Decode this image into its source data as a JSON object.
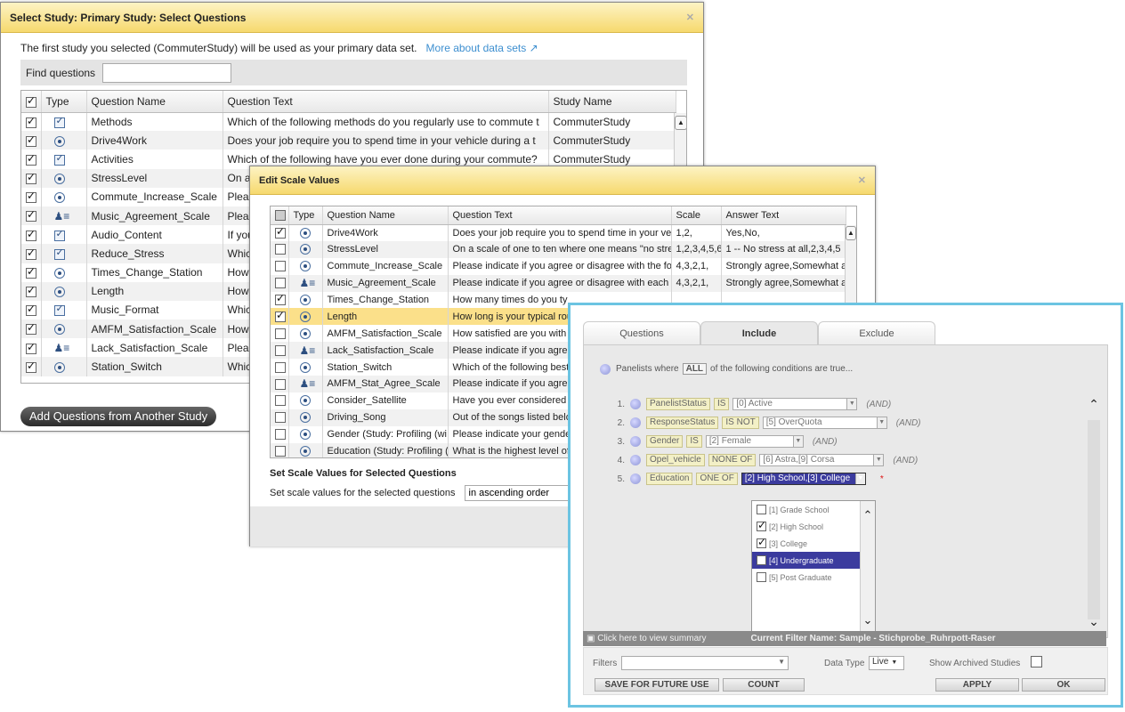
{
  "dialog1": {
    "title": "Select Study: Primary Study: Select Questions",
    "subtitle": "The first study you selected  (CommuterStudy)  will be used as your primary data set.",
    "more_link": "More about data sets",
    "find_label": "Find questions",
    "find_placeholder": "",
    "columns": [
      "Type",
      "Question Name",
      "Question Text",
      "Study Name"
    ],
    "rows": [
      {
        "checked": true,
        "type": "check",
        "name": "Methods",
        "text": "Which of the following methods do you regularly use to commute t",
        "study": "CommuterStudy"
      },
      {
        "checked": true,
        "type": "radio",
        "name": "Drive4Work",
        "text": "Does your job require you to spend time in your vehicle during a t",
        "study": "CommuterStudy"
      },
      {
        "checked": true,
        "type": "check",
        "name": "Activities",
        "text": "Which of the following have you ever done during your commute?",
        "study": "CommuterStudy"
      },
      {
        "checked": true,
        "type": "radio",
        "name": "StressLevel",
        "text": "On a",
        "study": ""
      },
      {
        "checked": true,
        "type": "radio",
        "name": "Commute_Increase_Scale",
        "text": "Pleas",
        "study": ""
      },
      {
        "checked": true,
        "type": "scale",
        "name": "Music_Agreement_Scale",
        "text": "Pleas",
        "study": ""
      },
      {
        "checked": true,
        "type": "check",
        "name": "Audio_Content",
        "text": "If you",
        "study": ""
      },
      {
        "checked": true,
        "type": "check",
        "name": "Reduce_Stress",
        "text": "Which",
        "study": ""
      },
      {
        "checked": true,
        "type": "radio",
        "name": "Times_Change_Station",
        "text": "How",
        "study": ""
      },
      {
        "checked": true,
        "type": "radio",
        "name": "Length",
        "text": "How",
        "study": ""
      },
      {
        "checked": true,
        "type": "check",
        "name": "Music_Format",
        "text": "Which",
        "study": ""
      },
      {
        "checked": true,
        "type": "radio",
        "name": "AMFM_Satisfaction_Scale",
        "text": "How",
        "study": ""
      },
      {
        "checked": true,
        "type": "scale",
        "name": "Lack_Satisfaction_Scale",
        "text": "Pleas",
        "study": ""
      },
      {
        "checked": true,
        "type": "radio",
        "name": "Station_Switch",
        "text": "Which",
        "study": ""
      }
    ],
    "add_button": "Add Questions from Another Study"
  },
  "dialog2": {
    "title": "Edit Scale Values",
    "columns": [
      "Type",
      "Question Name",
      "Question Text",
      "Scale",
      "Answer Text"
    ],
    "rows": [
      {
        "checked": true,
        "type": "radio",
        "name": "Drive4Work",
        "text": "Does your job require you to spend time in your ve",
        "scale": "1,2,",
        "answer": "Yes,No,"
      },
      {
        "checked": false,
        "type": "radio",
        "name": "StressLevel",
        "text": "On a scale of one to ten where one means \"no stres",
        "scale": "1,2,3,4,5,6",
        "answer": "1 -- No stress at all,2,3,4,5"
      },
      {
        "checked": false,
        "type": "radio",
        "name": "Commute_Increase_Scale",
        "text": "Please indicate if you agree or disagree with the fol",
        "scale": "4,3,2,1,",
        "answer": "Strongly agree,Somewhat a"
      },
      {
        "checked": false,
        "type": "scale",
        "name": "Music_Agreement_Scale",
        "text": "Please indicate if you agree or disagree with each o",
        "scale": "4,3,2,1,",
        "answer": "Strongly agree,Somewhat a"
      },
      {
        "checked": true,
        "type": "radio",
        "name": "Times_Change_Station",
        "text": "How many times do you ty",
        "scale": "",
        "answer": ""
      },
      {
        "checked": true,
        "type": "radio",
        "name": "Length",
        "text": "How long is your typical rou",
        "scale": "",
        "answer": "",
        "selected": true
      },
      {
        "checked": false,
        "type": "radio",
        "name": "AMFM_Satisfaction_Scale",
        "text": "How satisfied are you with",
        "scale": "",
        "answer": ""
      },
      {
        "checked": false,
        "type": "scale",
        "name": "Lack_Satisfaction_Scale",
        "text": "Please indicate if you agree",
        "scale": "",
        "answer": ""
      },
      {
        "checked": false,
        "type": "radio",
        "name": "Station_Switch",
        "text": "Which of the following best",
        "scale": "",
        "answer": ""
      },
      {
        "checked": false,
        "type": "scale",
        "name": "AMFM_Stat_Agree_Scale",
        "text": "Please indicate if you agree",
        "scale": "",
        "answer": ""
      },
      {
        "checked": false,
        "type": "radio",
        "name": "Consider_Satellite",
        "text": "Have you ever considered p",
        "scale": "",
        "answer": ""
      },
      {
        "checked": false,
        "type": "radio",
        "name": "Driving_Song",
        "text": "Out of the songs listed belo",
        "scale": "",
        "answer": ""
      },
      {
        "checked": false,
        "type": "radio",
        "name": "Gender (Study: Profiling (wi",
        "text": "Please indicate your gender",
        "scale": "",
        "answer": ""
      },
      {
        "checked": false,
        "type": "radio",
        "name": "Education (Study: Profiling (",
        "text": "What is the highest level of",
        "scale": "",
        "answer": ""
      }
    ],
    "section_title": "Set Scale Values for Selected Questions",
    "section_label": "Set scale values for the selected questions",
    "order_value": "in ascending order"
  },
  "dialog3": {
    "tabs": [
      "Questions",
      "Include",
      "Exclude"
    ],
    "head_pre": "Panelists where",
    "head_all": "ALL",
    "head_post": "of the following conditions are true...",
    "conditions": [
      {
        "num": "1.",
        "field": "PanelistStatus",
        "op": "IS",
        "value": "[0] Active",
        "join": "(AND)"
      },
      {
        "num": "2.",
        "field": "ResponseStatus",
        "op": "IS NOT",
        "value": "[5] OverQuota",
        "join": "(AND)"
      },
      {
        "num": "3.",
        "field": "Gender",
        "op": "IS",
        "value": "[2] Female",
        "join": "(AND)"
      },
      {
        "num": "4.",
        "field": "Opel_vehicle",
        "op": "NONE OF",
        "value": "[6] Astra,[9] Corsa",
        "join": "(AND)"
      },
      {
        "num": "5.",
        "field": "Education",
        "op": "ONE OF",
        "value": "[2] High School,[3] College",
        "join": "*"
      }
    ],
    "options": [
      {
        "label": "[1] Grade School",
        "checked": false
      },
      {
        "label": "[2] High School",
        "checked": true
      },
      {
        "label": "[3] College",
        "checked": true
      },
      {
        "label": "[4] Undergraduate",
        "checked": false
      },
      {
        "label": "[5] Post Graduate",
        "checked": false
      }
    ],
    "summary_link": "Click here to view summary",
    "filter_name": "Current Filter Name: Sample - Stichprobe_Ruhrpott-Raser",
    "filters_label": "Filters",
    "datatype_label": "Data Type",
    "datatype_value": "Live",
    "archived_label": "Show Archived Studies",
    "btn_save": "SAVE FOR FUTURE USE",
    "btn_count": "COUNT",
    "btn_apply": "APPLY",
    "btn_ok": "OK"
  }
}
